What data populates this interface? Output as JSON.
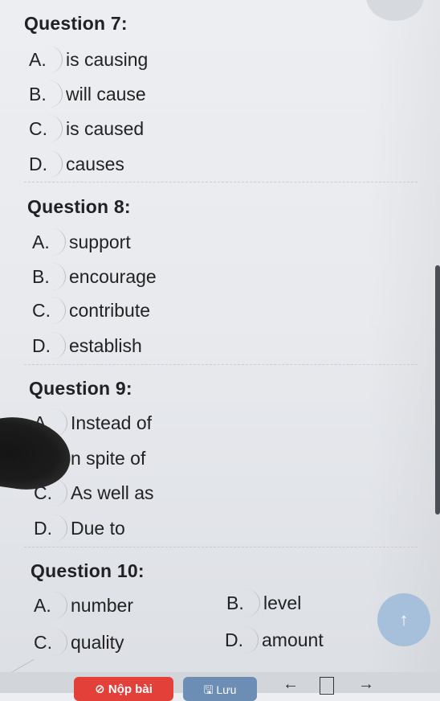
{
  "questions": [
    {
      "title": "Question 7:",
      "options": [
        {
          "letter": "A.",
          "text": "is causing"
        },
        {
          "letter": "B.",
          "text": "will cause"
        },
        {
          "letter": "C.",
          "text": "is caused"
        },
        {
          "letter": "D.",
          "text": "causes"
        }
      ]
    },
    {
      "title": "Question 8:",
      "options": [
        {
          "letter": "A.",
          "text": "support"
        },
        {
          "letter": "B.",
          "text": "encourage"
        },
        {
          "letter": "C.",
          "text": "contribute"
        },
        {
          "letter": "D.",
          "text": "establish"
        }
      ]
    },
    {
      "title": "Question 9:",
      "options": [
        {
          "letter": "A.",
          "text": "Instead of"
        },
        {
          "letter": "",
          "text": "n spite of"
        },
        {
          "letter": "C.",
          "text": "As well as"
        },
        {
          "letter": "D.",
          "text": "Due to"
        }
      ]
    },
    {
      "title": "Question 10:",
      "options": [
        {
          "letter": "A.",
          "text": "number"
        },
        {
          "letter": "B.",
          "text": "level"
        },
        {
          "letter": "C.",
          "text": "quality"
        },
        {
          "letter": "D.",
          "text": "amount"
        }
      ]
    }
  ],
  "footer": {
    "submit_label": "⊘ Nộp bài",
    "save_label": "🖫 Lưu",
    "back_icon": "←",
    "forward_icon": "→",
    "scroll_top_icon": "↑"
  },
  "colors": {
    "submit": "#e4403a",
    "save": "#6c8eb4",
    "scroll_top": "#a6c0dc"
  }
}
